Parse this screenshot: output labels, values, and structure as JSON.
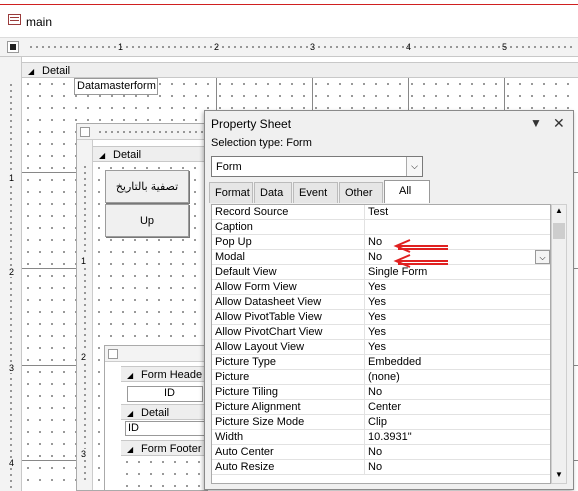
{
  "window": {
    "title": "main"
  },
  "ruler": {
    "h_marks": [
      "1",
      "2",
      "3",
      "4",
      "5"
    ],
    "v_marks": [
      "1",
      "2",
      "3",
      "4"
    ]
  },
  "form": {
    "detail_label": "Detail",
    "label_text": "Datamasterform"
  },
  "subform1": {
    "detail_label": "Detail",
    "button1": "تصفية بالتاريخ",
    "button2": "Up",
    "ruler_marks": [
      "1",
      "2",
      "3"
    ]
  },
  "subform2": {
    "header_label": "Form Heade",
    "id_label": "ID",
    "detail_label": "Detail",
    "id_field": "ID",
    "footer_label": "Form Footer"
  },
  "property_sheet": {
    "title": "Property Sheet",
    "selection_type_label": "Selection type:",
    "selection_type_value": "Form",
    "object": "Form",
    "tabs": [
      "Format",
      "Data",
      "Event",
      "Other",
      "All"
    ],
    "active_tab": "All",
    "properties": [
      {
        "name": "Record Source",
        "value": "Test"
      },
      {
        "name": "Caption",
        "value": ""
      },
      {
        "name": "Pop Up",
        "value": "No"
      },
      {
        "name": "Modal",
        "value": "No"
      },
      {
        "name": "Default View",
        "value": "Single Form"
      },
      {
        "name": "Allow Form View",
        "value": "Yes"
      },
      {
        "name": "Allow Datasheet View",
        "value": "Yes"
      },
      {
        "name": "Allow PivotTable View",
        "value": "Yes"
      },
      {
        "name": "Allow PivotChart View",
        "value": "Yes"
      },
      {
        "name": "Allow Layout View",
        "value": "Yes"
      },
      {
        "name": "Picture Type",
        "value": "Embedded"
      },
      {
        "name": "Picture",
        "value": "(none)"
      },
      {
        "name": "Picture Tiling",
        "value": "No"
      },
      {
        "name": "Picture Alignment",
        "value": "Center"
      },
      {
        "name": "Picture Size Mode",
        "value": "Clip"
      },
      {
        "name": "Width",
        "value": "10.3931\""
      },
      {
        "name": "Auto Center",
        "value": "No"
      },
      {
        "name": "Auto Resize",
        "value": "No"
      }
    ]
  },
  "colors": {
    "annotation_arrow": "#e02020",
    "title_accent": "#d02020"
  }
}
